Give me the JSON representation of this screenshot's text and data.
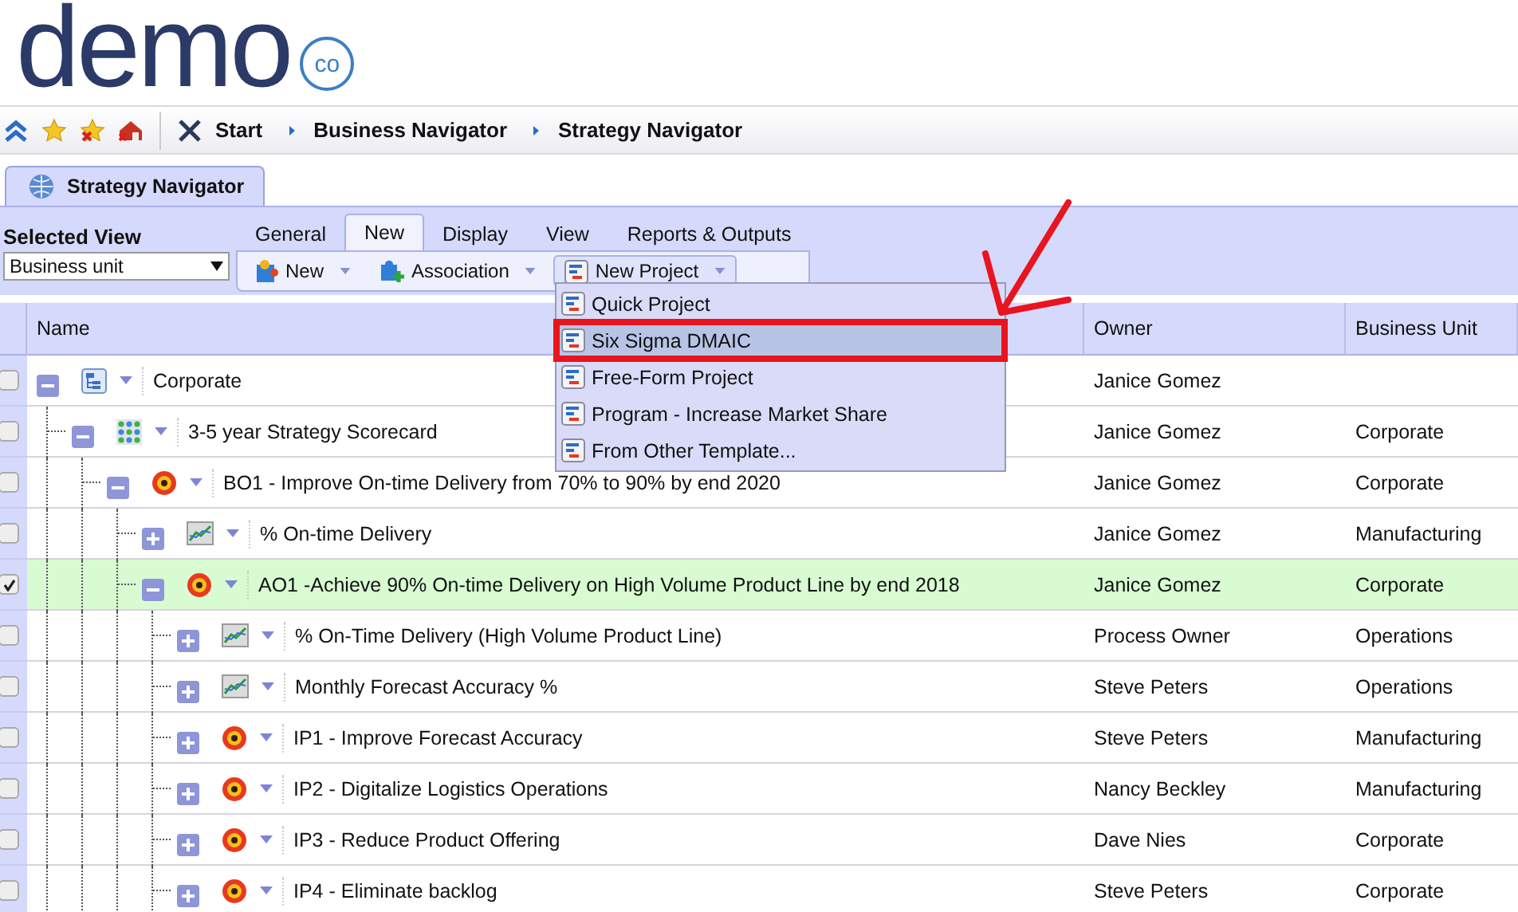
{
  "logo": {
    "word": "demo",
    "badge": "co"
  },
  "breadcrumb": [
    {
      "label": "Start",
      "kind": "home"
    },
    {
      "label": "Business Navigator",
      "kind": "crumb"
    },
    {
      "label": "Strategy Navigator",
      "kind": "crumb"
    }
  ],
  "page_tab": {
    "label": "Strategy Navigator",
    "selected": true
  },
  "selected_view": {
    "label": "Selected View",
    "value": "Business unit"
  },
  "ribbon_tabs": [
    {
      "label": "General",
      "selected": false
    },
    {
      "label": "New",
      "selected": true
    },
    {
      "label": "Display",
      "selected": false
    },
    {
      "label": "View",
      "selected": false
    },
    {
      "label": "Reports & Outputs",
      "selected": false
    }
  ],
  "toolbar": [
    {
      "label": "New",
      "kind": "new",
      "open": false
    },
    {
      "label": "Association",
      "kind": "association",
      "open": false
    },
    {
      "label": "New Project",
      "kind": "project",
      "open": true
    }
  ],
  "menu": [
    {
      "label": "Quick Project",
      "highlighted": false
    },
    {
      "label": "Six Sigma DMAIC",
      "highlighted": true
    },
    {
      "label": "Free-Form Project",
      "highlighted": false
    },
    {
      "label": "Program - Increase Market Share",
      "highlighted": false
    },
    {
      "label": "From Other Template...",
      "highlighted": false
    }
  ],
  "grid": {
    "columns": [
      "Name",
      "Owner",
      "Business Unit"
    ],
    "rows": [
      {
        "name": "Corporate",
        "owner": "Janice Gomez",
        "kind": "org",
        "expanded": true,
        "checked": false,
        "selected": false,
        "children": [
          {
            "name": "3-5 year Strategy Scorecard",
            "owner": "Janice Gomez",
            "unit": "Corporate",
            "kind": "scorecard",
            "expanded": true,
            "checked": false,
            "selected": false,
            "children": [
              {
                "name": "BO1 - Improve On-time Delivery from 70% to 90% by end 2020",
                "owner": "Janice Gomez",
                "unit": "Corporate",
                "kind": "objective",
                "expanded": true,
                "checked": false,
                "selected": false,
                "children": [
                  {
                    "name": "% On-time Delivery",
                    "owner": "Janice Gomez",
                    "unit": "Manufacturing",
                    "kind": "kpi",
                    "expanded": false,
                    "checked": false,
                    "selected": false
                  },
                  {
                    "name": "AO1 -Achieve 90% On-time Delivery on High Volume Product Line by end 2018",
                    "owner": "Janice Gomez",
                    "unit": "Corporate",
                    "kind": "objective",
                    "expanded": true,
                    "checked": true,
                    "selected": true,
                    "children": [
                      {
                        "name": "% On-Time Delivery (High Volume Product Line)",
                        "owner": "Process Owner",
                        "unit": "Operations",
                        "kind": "kpi",
                        "expanded": false,
                        "checked": false,
                        "selected": false
                      },
                      {
                        "name": "Monthly Forecast Accuracy %",
                        "owner": "Steve Peters",
                        "unit": "Operations",
                        "kind": "kpi",
                        "expanded": false,
                        "checked": false,
                        "selected": false
                      },
                      {
                        "name": "IP1 - Improve Forecast Accuracy",
                        "owner": "Steve Peters",
                        "unit": "Manufacturing",
                        "kind": "objective",
                        "expanded": false,
                        "checked": false,
                        "selected": false
                      },
                      {
                        "name": "IP2 - Digitalize Logistics Operations",
                        "owner": "Nancy Beckley",
                        "unit": "Manufacturing",
                        "kind": "objective",
                        "expanded": false,
                        "checked": false,
                        "selected": false
                      },
                      {
                        "name": "IP3 - Reduce Product Offering",
                        "owner": "Dave Nies",
                        "unit": "Corporate",
                        "kind": "objective",
                        "expanded": false,
                        "checked": false,
                        "selected": false
                      },
                      {
                        "name": "IP4 - Eliminate backlog",
                        "owner": "Steve Peters",
                        "unit": "Corporate",
                        "kind": "objective",
                        "expanded": false,
                        "checked": false,
                        "selected": false
                      }
                    ]
                  }
                ]
              }
            ]
          }
        ]
      }
    ]
  }
}
